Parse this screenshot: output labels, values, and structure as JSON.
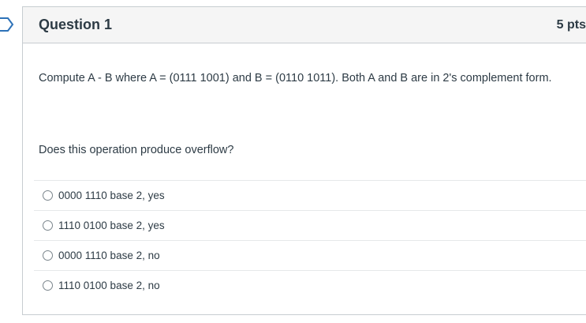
{
  "question": {
    "title": "Question 1",
    "points": "5 pts",
    "text": "Compute A - B where A = (0111 1001) and B = (0110 1011).  Both A and B are in 2's complement form.",
    "prompt": "Does this operation produce overflow?"
  },
  "answers": [
    {
      "label": "0000 1110 base 2, yes",
      "selected": false
    },
    {
      "label": "1110 0100 base 2, yes",
      "selected": false
    },
    {
      "label": "0000 1110 base 2, no",
      "selected": false
    },
    {
      "label": "1110 0100 base 2, no",
      "selected": false
    }
  ],
  "colors": {
    "text": "#2d3b45",
    "border": "#c7cdd1",
    "header_bg": "#f5f5f5",
    "flag_stroke": "#2d72b8"
  },
  "icons": {
    "flag": "bookmark-flag-icon",
    "radio": "radio-button-icon"
  }
}
